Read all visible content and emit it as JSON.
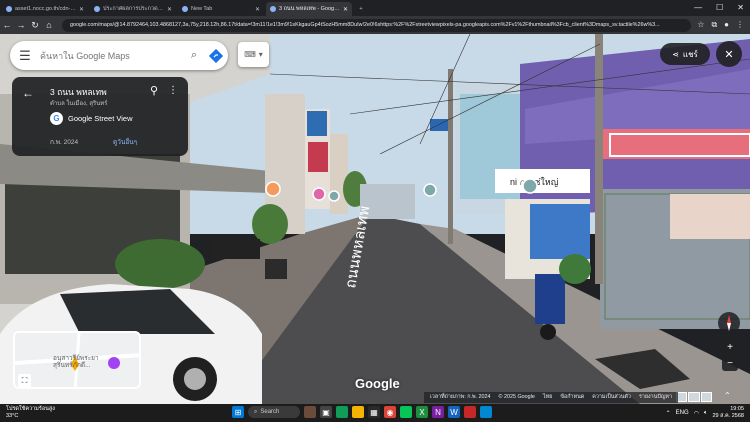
{
  "browser": {
    "tabs": [
      {
        "title": "asset1.nocc.go.th/cdn-app/Pr..."
      },
      {
        "title": "ประกาศผลการประกวดราคา - ทดสอบ..."
      },
      {
        "title": "New Tab"
      },
      {
        "title": "3 ถนน พหลเทพ - Google Maps",
        "active": true
      }
    ],
    "address": "google.com/maps/@14.8792464,103.4868127,3a,75y,218.12h,86.17t/data=!3m11!1e1!3m9!1sKkgauGp4tSozH5mm8DuIw!2e0!6shttps:%2F%2Fstreetviewpixels-pa.googleapis.com%2Fv1%2Fthumbnail%3Fcb_client%3Dmaps_sv.tactile%26w%3..."
  },
  "maps": {
    "search_placeholder": "ค้นหาใน Google Maps",
    "place_title": "3 ถนน พหลเทพ",
    "place_subtitle": "ตำบล ในเมือง, สุรินทร์",
    "service_label": "Google Street View",
    "capture_date": "ก.พ. 2024",
    "see_more": "ดูวันอื่นๆ",
    "share_label": "แชร์",
    "minimap_label": "อนุสาวรีย์พระยาสุรินทร์ภักดี...",
    "google_logo": "Google",
    "attribution": [
      "เวลาที่ถ่ายภาพ: ก.พ. 2024",
      "© 2025 Google",
      "ไทย",
      "ข้อกำหนด",
      "ความเป็นส่วนตัว",
      "รายงานปัญหา"
    ],
    "road_marking": "ถนนพหลเทพ"
  },
  "taskbar": {
    "weather_line1": "โปรดใช้ความร้อนสูง",
    "weather_line2": "33°C",
    "search_label": "Search",
    "lang": "ENG",
    "time": "19:05",
    "date": "29 ส.ค. 2568"
  },
  "colors": {
    "sky": "#c7d8e6",
    "road": "#4a4a4a",
    "shophouse_purple": "#6f5fae",
    "signboard": "#ffffff"
  }
}
